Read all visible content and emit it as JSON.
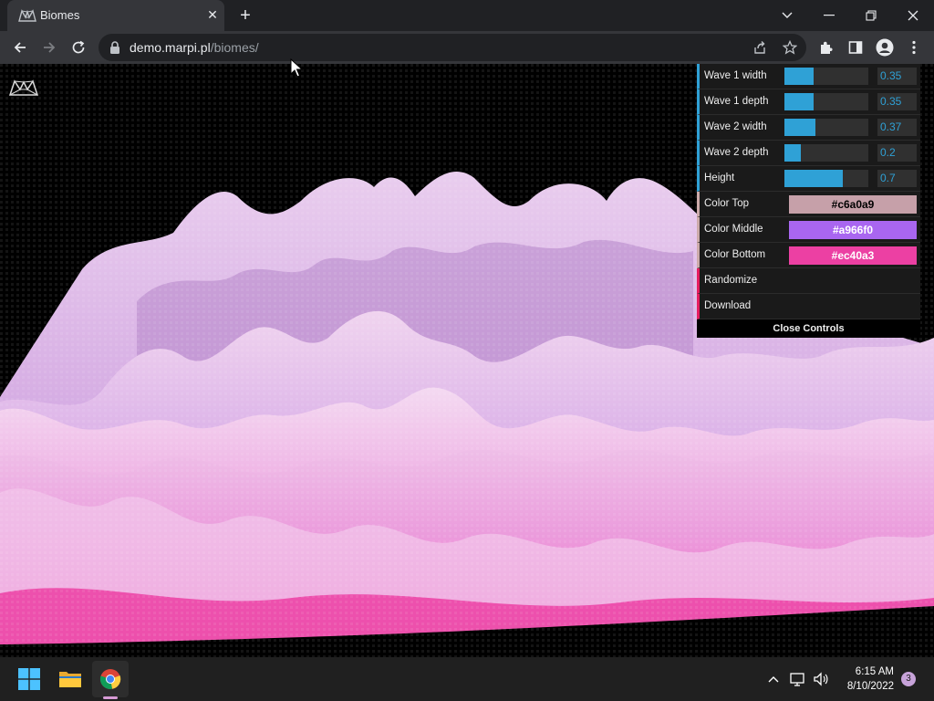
{
  "browser": {
    "tab_title": "Biomes",
    "url_domain": "demo.marpi.pl",
    "url_path": "/biomes/"
  },
  "controls": {
    "numeric": [
      {
        "label": "Wave 1 width",
        "value": 0.35
      },
      {
        "label": "Wave 1 depth",
        "value": 0.35
      },
      {
        "label": "Wave 2 width",
        "value": 0.37
      },
      {
        "label": "Wave 2 depth",
        "value": 0.2
      },
      {
        "label": "Height",
        "value": 0.7
      }
    ],
    "colors": [
      {
        "label": "Color Top",
        "value": "#c6a0a9",
        "text_color": "#000000"
      },
      {
        "label": "Color Middle",
        "value": "#a966f0",
        "text_color": "#ffffff"
      },
      {
        "label": "Color Bottom",
        "value": "#ec40a3",
        "text_color": "#ffffff"
      }
    ],
    "functions": [
      "Randomize",
      "Download"
    ],
    "close_label": "Close Controls"
  },
  "taskbar": {
    "time": "6:15 AM",
    "date": "8/10/2022",
    "notification_count": "3"
  }
}
